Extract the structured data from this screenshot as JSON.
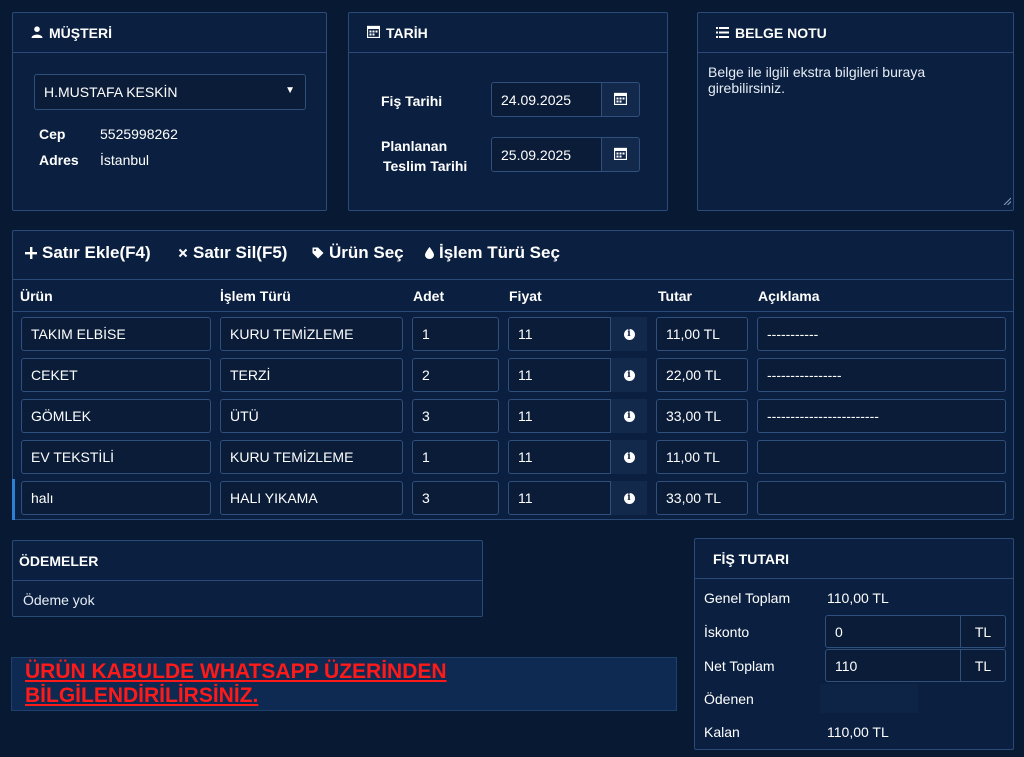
{
  "customer": {
    "title": "MÜŞTERİ",
    "selected": "H.MUSTAFA KESKİN",
    "phone_label": "Cep",
    "phone": "5525998262",
    "address_label": "Adres",
    "address": "İstanbul"
  },
  "date": {
    "title": "TARİH",
    "receipt_date_label": "Fiş Tarihi",
    "receipt_date": "24.09.2025",
    "planned_label_1": "Planlanan",
    "planned_label_2": "Teslim Tarihi",
    "planned_date": "25.09.2025"
  },
  "note": {
    "title": "BELGE NOTU",
    "placeholder": "Belge ile ilgili ekstra bilgileri buraya girebilirsiniz."
  },
  "toolbar": {
    "add_row": "Satır Ekle(F4)",
    "delete_row": "Satır Sil(F5)",
    "select_product": "Ürün Seç",
    "select_process": "İşlem Türü Seç"
  },
  "table": {
    "headers": [
      "Ürün",
      "İşlem Türü",
      "Adet",
      "Fiyat",
      "Tutar",
      "Açıklama"
    ],
    "rows": [
      {
        "product": "TAKIM ELBİSE",
        "process": "KURU TEMİZLEME",
        "qty": "1",
        "price": "11",
        "total": "11,00 TL",
        "desc": "-----------"
      },
      {
        "product": "CEKET",
        "process": "TERZİ",
        "qty": "2",
        "price": "11",
        "total": "22,00 TL",
        "desc": "----------------"
      },
      {
        "product": "GÖMLEK",
        "process": "ÜTÜ",
        "qty": "3",
        "price": "11",
        "total": "33,00 TL",
        "desc": "------------------------"
      },
      {
        "product": "EV TEKSTİLİ",
        "process": "KURU TEMİZLEME",
        "qty": "1",
        "price": "11",
        "total": "11,00 TL",
        "desc": ""
      },
      {
        "product": "halı",
        "process": "HALI YIKAMA",
        "qty": "3",
        "price": "11",
        "total": "33,00 TL",
        "desc": ""
      }
    ]
  },
  "payments": {
    "title": "ÖDEMELER",
    "empty_text": "Ödeme yok"
  },
  "warning": {
    "text": "ÜRÜN KABULDE WHATSAPP ÜZERİNDEN BİLGİLENDİRİLİRSİNİZ.",
    "color": "#ff1a1a"
  },
  "summary": {
    "title": "FİŞ TUTARI",
    "gross_label": "Genel Toplam",
    "gross": "110,00 TL",
    "discount_label": "İskonto",
    "discount": "0",
    "discount_unit": "TL",
    "net_label": "Net Toplam",
    "net": "110",
    "net_unit": "TL",
    "paid_label": "Ödenen",
    "paid": "",
    "remaining_label": "Kalan",
    "remaining": "110,00 TL"
  },
  "colors": {
    "background": "#081a33",
    "panel": "#0b2040",
    "border": "#2a4a78",
    "accent": "#2b7fd4"
  }
}
